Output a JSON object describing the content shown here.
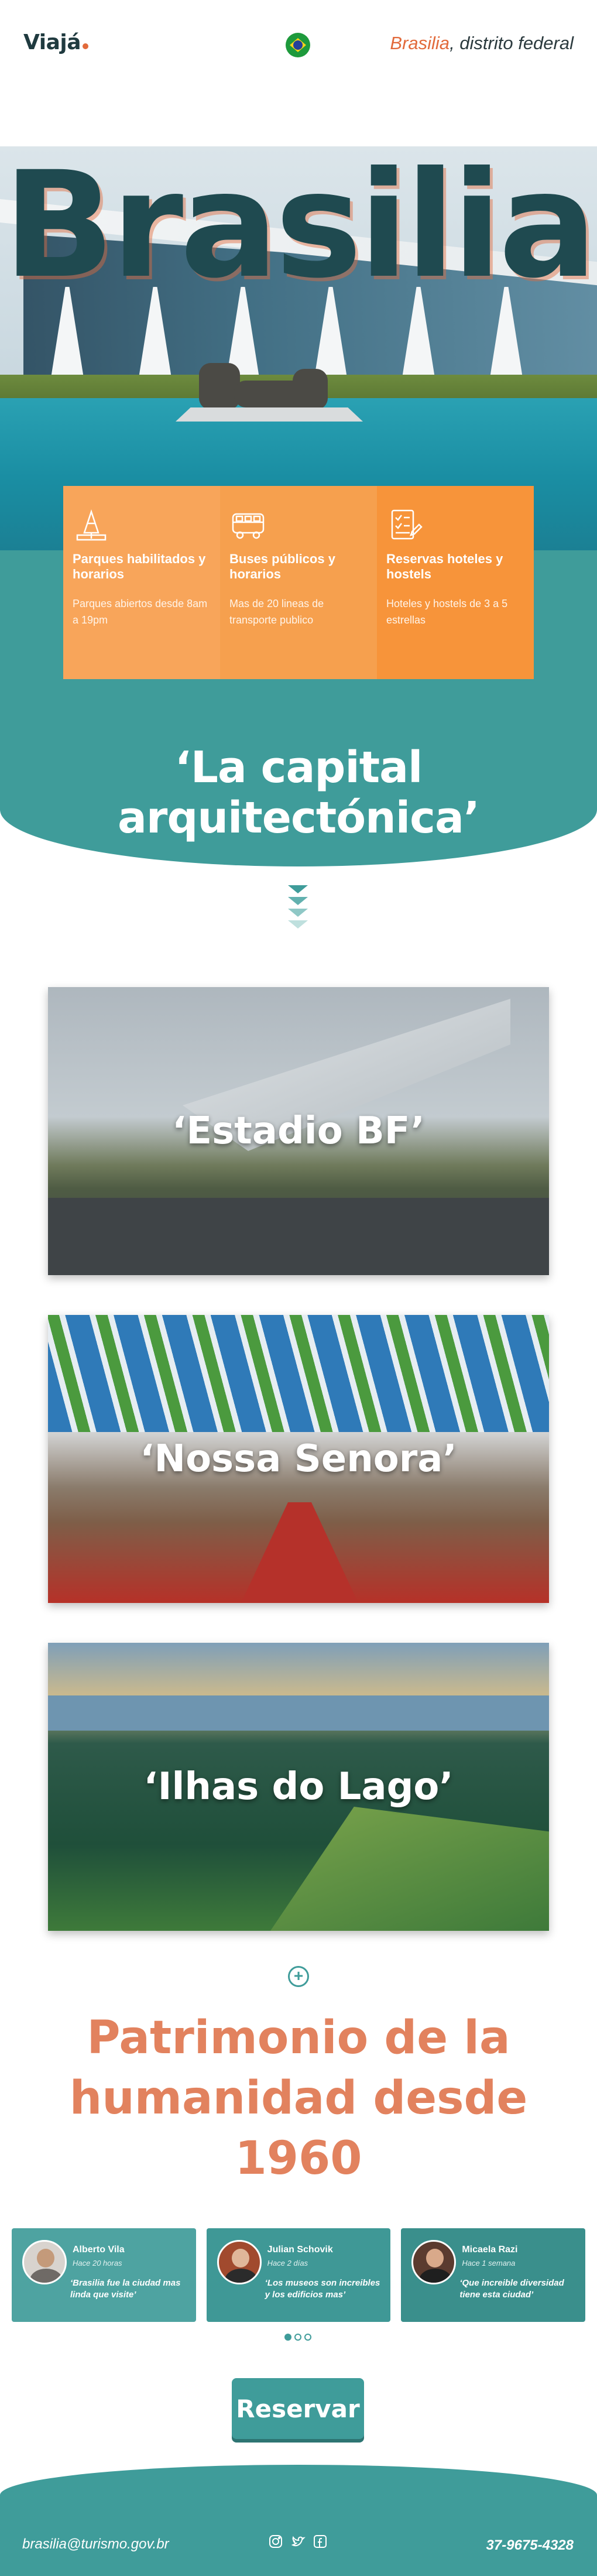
{
  "header": {
    "logo": "Viajá",
    "location_city": "Brasilia",
    "location_rest": ", distrito federal"
  },
  "hero": {
    "title": "Brasilia"
  },
  "features": [
    {
      "icon": "park-icon",
      "title": "Parques habilitados y horarios",
      "desc": "Parques abiertos desde 8am a 19pm"
    },
    {
      "icon": "bus-icon",
      "title": "Buses públicos y horarios",
      "desc": "Mas de 20 lineas de transporte publico"
    },
    {
      "icon": "hotel-checklist-icon",
      "title": "Reservas hoteles y hostels",
      "desc": "Hoteles y hostels de 3 a 5 estrellas"
    }
  ],
  "tagline": "‘La capital arquitectónica’",
  "cards": [
    {
      "title": "‘Estadio BF’"
    },
    {
      "title": "‘Nossa Senora’"
    },
    {
      "title": "‘Ilhas do Lago’"
    }
  ],
  "heritage": "Patrimonio de la humanidad desde 1960",
  "testimonials": [
    {
      "name": "Alberto Vila",
      "time": "Hace 20 horas",
      "quote": "‘Brasilia fue la ciudad mas linda que visite’"
    },
    {
      "name": "Julian Schovik",
      "time": "Hace 2 días",
      "quote": "‘Los museos son increibles y los edificios mas’"
    },
    {
      "name": "Micaela Razi",
      "time": "Hace 1 semana",
      "quote": "‘Que increible diversidad tiene esta ciudad’"
    }
  ],
  "reserve_label": "Reservar",
  "footer": {
    "email": "brasilia@turismo.gov.br",
    "phone": "37-9675-4328",
    "social": [
      "instagram-icon",
      "twitter-icon",
      "facebook-icon"
    ]
  },
  "colors": {
    "teal": "#3f9c9a",
    "orange": "#f7943a",
    "coral": "#e2825e",
    "dark": "#1f4a50"
  }
}
